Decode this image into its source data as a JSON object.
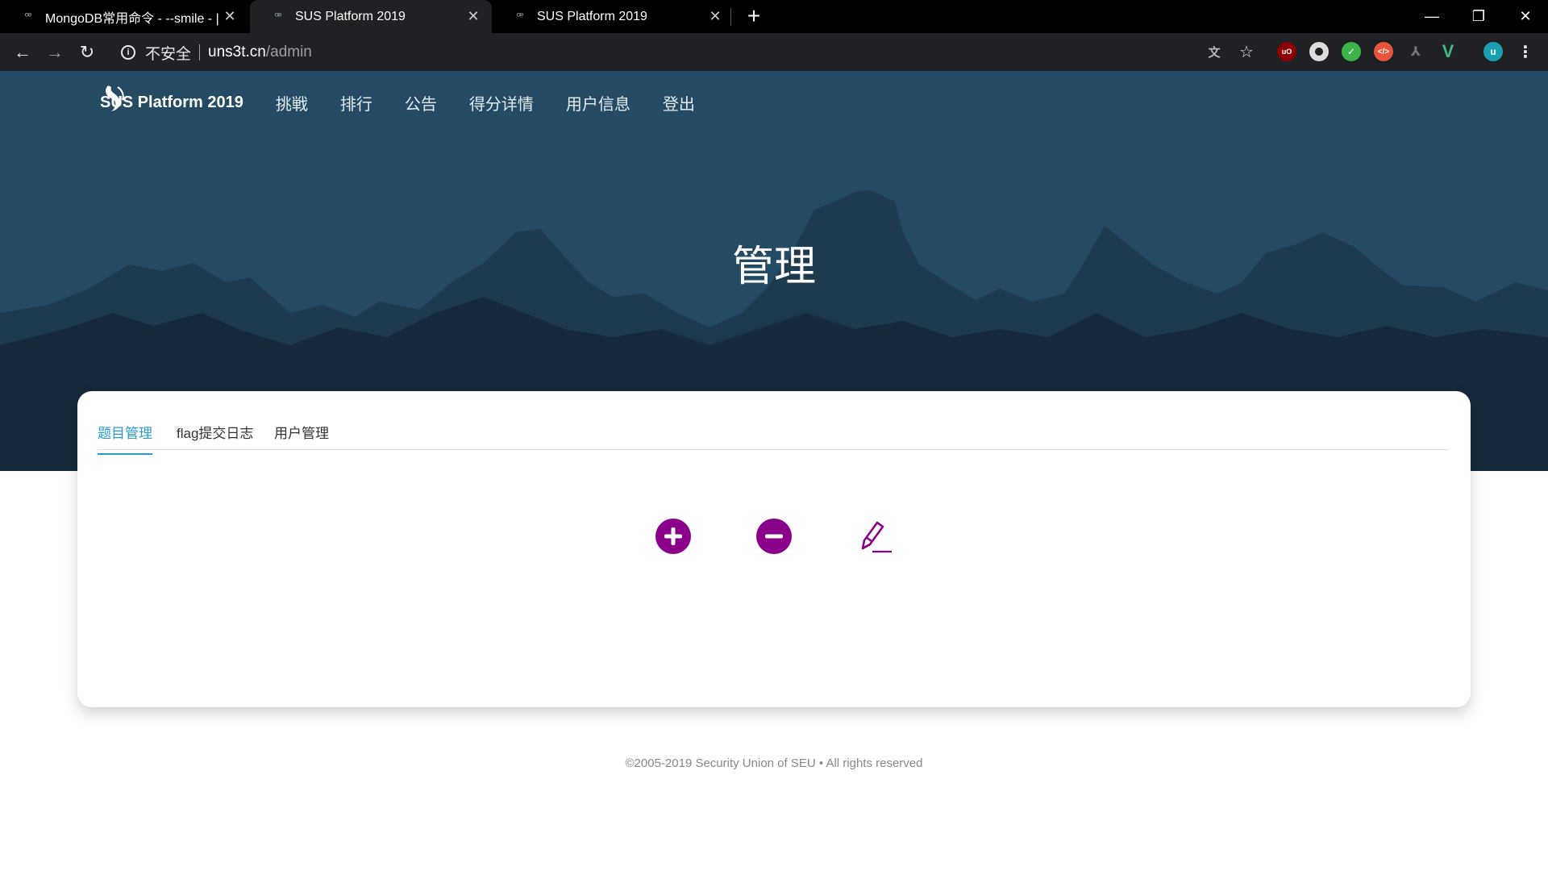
{
  "browser": {
    "tabs": [
      {
        "title": "MongoDB常用命令 - --smile - |",
        "active": false
      },
      {
        "title": "SUS Platform 2019",
        "active": true
      },
      {
        "title": "SUS Platform 2019",
        "active": false
      }
    ],
    "new_tab": "+",
    "security_label": "不安全",
    "url_host": "uns3t.cn",
    "url_path": "/admin"
  },
  "site": {
    "brand": "SUS Platform 2019",
    "nav": [
      {
        "label": "挑戦"
      },
      {
        "label": "排行"
      },
      {
        "label": "公告"
      },
      {
        "label": "得分详情"
      },
      {
        "label": "用户信息"
      },
      {
        "label": "登出"
      }
    ],
    "page_title": "管理"
  },
  "admin": {
    "tabs": [
      {
        "label": "题目管理",
        "active": true
      },
      {
        "label": "flag提交日志",
        "active": false
      },
      {
        "label": "用户管理",
        "active": false
      }
    ],
    "actions": [
      {
        "icon": "add-circle-icon"
      },
      {
        "icon": "remove-circle-icon"
      },
      {
        "icon": "edit-pencil-icon"
      }
    ],
    "accent_color": "#8b008b",
    "tab_active_color": "#2b9ad3"
  },
  "footer": {
    "text": "©2005-2019 Security Union of SEU • All rights reserved"
  }
}
